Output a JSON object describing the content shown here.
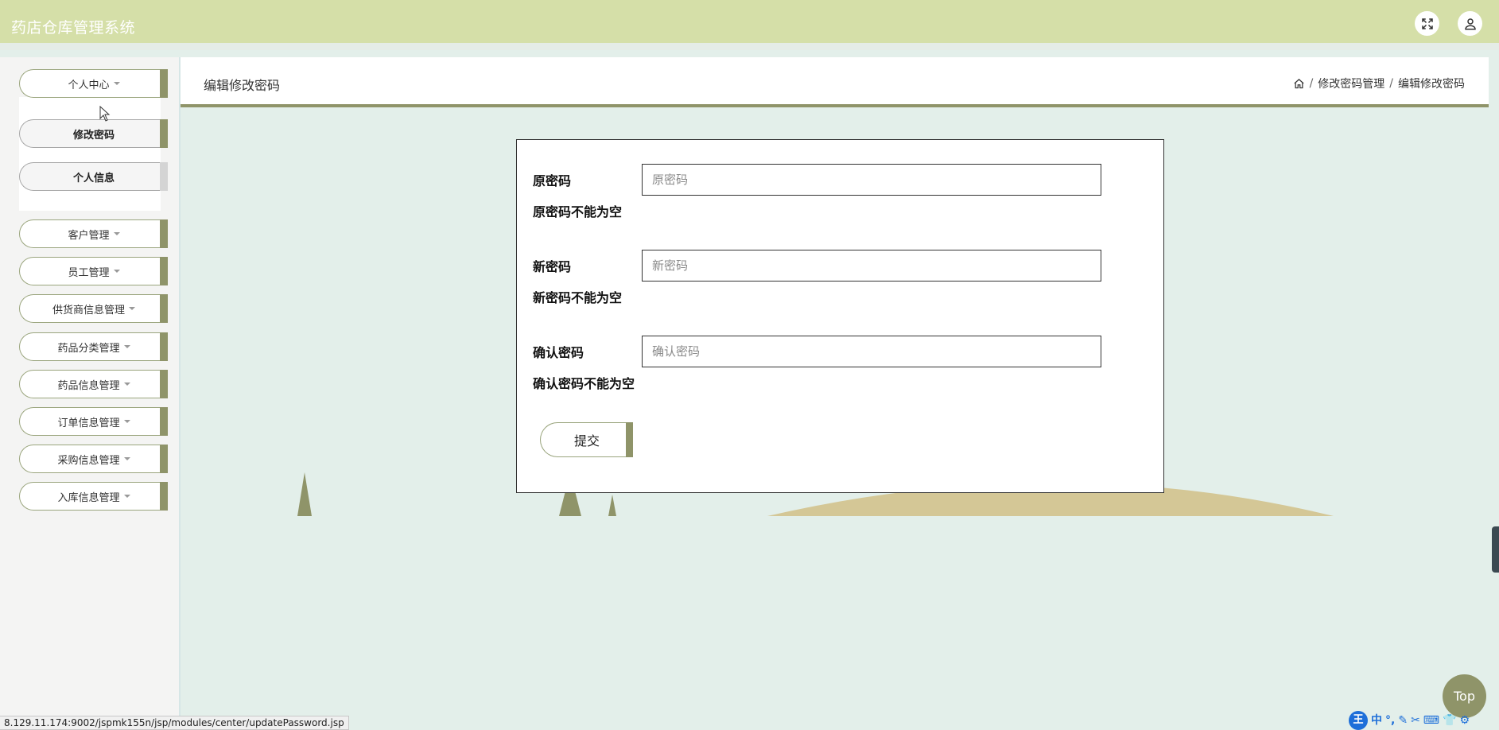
{
  "app": {
    "title": "药店仓库管理系统"
  },
  "header": {
    "fullscreen_icon": "expand-icon",
    "user_icon": "user-icon"
  },
  "sidebar": {
    "items": [
      {
        "label": "个人中心",
        "icon": "caret-down-icon"
      },
      {
        "label": "客户管理",
        "icon": "caret-down-icon"
      },
      {
        "label": "员工管理",
        "icon": "caret-down-icon"
      },
      {
        "label": "供货商信息管理",
        "icon": "caret-down-icon"
      },
      {
        "label": "药品分类管理",
        "icon": "caret-down-icon"
      },
      {
        "label": "药品信息管理",
        "icon": "caret-down-icon"
      },
      {
        "label": "订单信息管理",
        "icon": "caret-down-icon"
      },
      {
        "label": "采购信息管理",
        "icon": "caret-down-icon"
      },
      {
        "label": "入库信息管理",
        "icon": "caret-down-icon"
      }
    ],
    "submenu": [
      {
        "label": "修改密码"
      },
      {
        "label": "个人信息"
      }
    ]
  },
  "content": {
    "title": "编辑修改密码",
    "breadcrumb": [
      "修改密码管理",
      "编辑修改密码"
    ],
    "breadcrumb_sep": "/"
  },
  "form": {
    "old_password": {
      "label": "原密码",
      "placeholder": "原密码",
      "value": "",
      "error": "原密码不能为空"
    },
    "new_password": {
      "label": "新密码",
      "placeholder": "新密码",
      "value": "",
      "error": "新密码不能为空"
    },
    "confirm_password": {
      "label": "确认密码",
      "placeholder": "确认密码",
      "value": "",
      "error": "确认密码不能为空"
    },
    "submit_label": "提交"
  },
  "misc": {
    "top_button": "Top",
    "status_url": "8.129.11.174:9002/jspmk155n/jsp/modules/center/updatePassword.jsp",
    "ime": {
      "logo": "王",
      "mode": "中"
    }
  },
  "colors": {
    "header_bg": "#d5dfa8",
    "accent": "#8f9469",
    "page_bg": "#e3efea",
    "sidebar_bg": "#f4f4f3"
  }
}
